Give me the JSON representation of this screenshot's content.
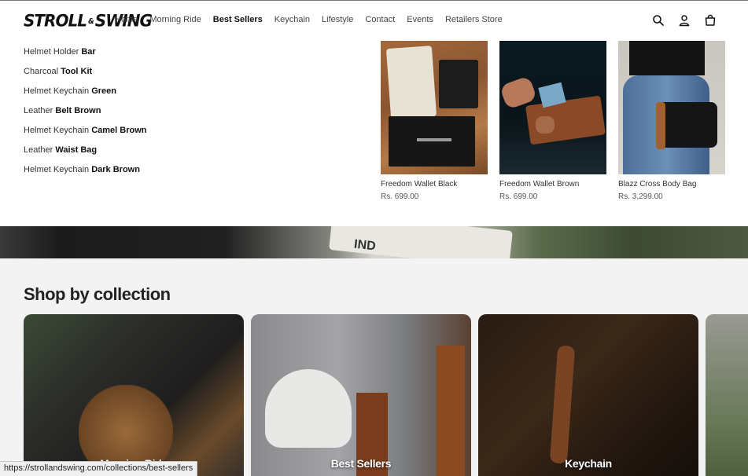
{
  "brand": {
    "logo_text": "STROLL",
    "logo_amp": "&",
    "logo_text2": "SWING"
  },
  "nav": [
    {
      "label": "Home",
      "active": false
    },
    {
      "label": "Morning Ride",
      "active": false
    },
    {
      "label": "Best Sellers",
      "active": true
    },
    {
      "label": "Keychain",
      "active": false
    },
    {
      "label": "Lifestyle",
      "active": false
    },
    {
      "label": "Contact",
      "active": false
    },
    {
      "label": "Events",
      "active": false
    },
    {
      "label": "Retailers Store",
      "active": false
    }
  ],
  "header_icons": [
    "search-icon",
    "account-icon",
    "cart-icon"
  ],
  "menu": {
    "items": [
      {
        "plain": "Helmet Holder ",
        "bold": "Bar"
      },
      {
        "plain": "Charcoal ",
        "bold": "Tool Kit"
      },
      {
        "plain": "Helmet Keychain ",
        "bold": "Green"
      },
      {
        "plain": "Leather ",
        "bold": "Belt Brown"
      },
      {
        "plain": "Helmet Keychain ",
        "bold": "Camel Brown"
      },
      {
        "plain": "Leather ",
        "bold": "Waist Bag"
      },
      {
        "plain": "Helmet Keychain ",
        "bold": "Dark Brown"
      }
    ]
  },
  "products": [
    {
      "title": "Freedom Wallet Black",
      "price": "Rs. 699.00"
    },
    {
      "title": "Freedom Wallet Brown",
      "price": "Rs. 699.00"
    },
    {
      "title": "Blazz Cross Body Bag",
      "price": "Rs. 3,299.00"
    }
  ],
  "banner": {
    "plate_text": "IND"
  },
  "collection": {
    "title": "Shop by collection",
    "cards": [
      {
        "label": "Morning Ride"
      },
      {
        "label": "Best Sellers"
      },
      {
        "label": "Keychain"
      }
    ]
  },
  "status_url": "https://strollandswing.com/collections/best-sellers"
}
